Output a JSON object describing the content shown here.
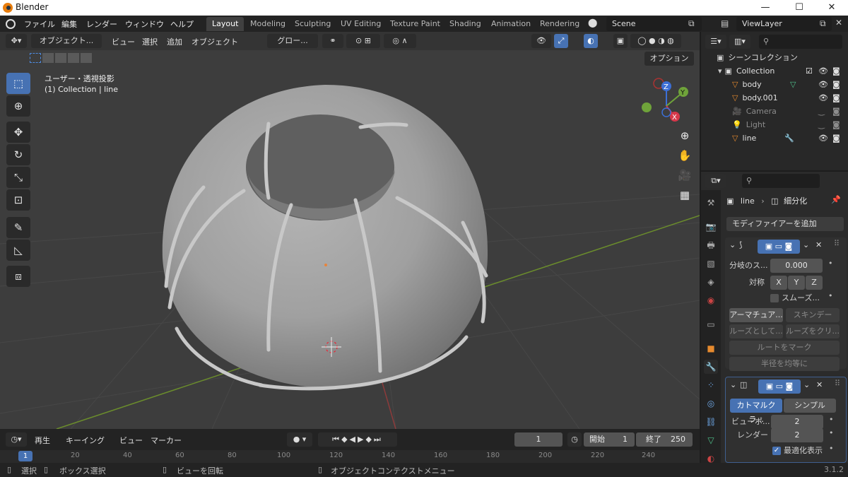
{
  "window": {
    "title": "Blender",
    "min_icon": "—",
    "max_icon": "☐",
    "close_icon": "✕"
  },
  "menus": [
    "ファイル",
    "編集",
    "レンダー",
    "ウィンドウ",
    "ヘルプ"
  ],
  "workspaces": [
    "Layout",
    "Modeling",
    "Sculpting",
    "UV Editing",
    "Texture Paint",
    "Shading",
    "Animation",
    "Rendering"
  ],
  "active_workspace": "Layout",
  "scene": "Scene",
  "view_layer": "ViewLayer",
  "viewport_header": {
    "mode": "オブジェクト...",
    "menus": [
      "ビュー",
      "選択",
      "追加",
      "オブジェクト"
    ],
    "transform": "グロー...",
    "options": "オプション"
  },
  "viewport_overlay": {
    "view_name": "ユーザー・透視投影",
    "collection_line": "(1) Collection | line"
  },
  "gizmo": {
    "z": "Z",
    "y": "Y",
    "x": "X"
  },
  "timeline": {
    "menus": [
      "再生",
      "キーイング",
      "ビュー",
      "マーカー"
    ],
    "current_frame": "1",
    "start_label": "開始",
    "start": "1",
    "end_label": "終了",
    "end": "250",
    "ruler": [
      "1",
      "20",
      "40",
      "60",
      "80",
      "100",
      "120",
      "140",
      "160",
      "180",
      "200",
      "220",
      "240"
    ]
  },
  "status": {
    "select": "選択",
    "box_select": "ボックス選択",
    "rotate": "ビューを回転",
    "context_menu": "オブジェクトコンテクストメニュー",
    "version": "3.1.2"
  },
  "outliner": {
    "root": "シーンコレクション",
    "collection": "Collection",
    "items": [
      {
        "name": "body",
        "dim": false
      },
      {
        "name": "body.001",
        "dim": false
      },
      {
        "name": "Camera",
        "dim": true
      },
      {
        "name": "Light",
        "dim": true
      },
      {
        "name": "line",
        "dim": false
      }
    ]
  },
  "properties": {
    "object": "line",
    "modifier_crumb": "細分化",
    "add_modifier": "モディファイアーを追加",
    "skin": {
      "branch_label": "分岐のス...",
      "branch_value": "0.000",
      "symmetry_label": "対称",
      "axes": [
        "X",
        "Y",
        "Z"
      ],
      "smooth_label": "スムーズ...",
      "armature_btn": "アーマチュア...",
      "skin_data_btn": "スキンデータ...",
      "loose_btn": "ルーズとして...",
      "clear_loose_btn": "ルーズをクリ...",
      "mark_root_btn": "ルートをマーク",
      "equalize_btn": "半径を均等に"
    },
    "subsurf": {
      "catmull": "カトマルクラ...",
      "simple": "シンプル",
      "viewport_label": "ビューポ...",
      "viewport_value": "2",
      "render_label": "レンダー",
      "render_value": "2",
      "optimal_label": "最適化表示"
    }
  }
}
